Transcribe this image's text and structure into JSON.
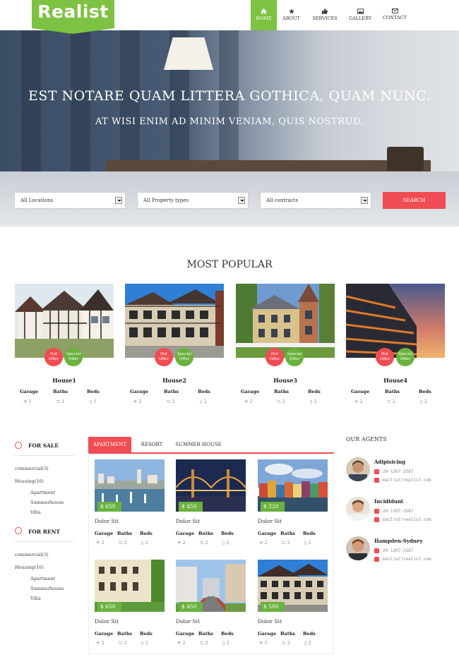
{
  "header": {
    "logo": "Realist",
    "nav": [
      {
        "label": "HOME",
        "icon": "home-icon",
        "active": true
      },
      {
        "label": "ABOUT",
        "icon": "user-icon",
        "active": false
      },
      {
        "label": "SERVICES",
        "icon": "thumbs-up-icon",
        "active": false
      },
      {
        "label": "GALLERY",
        "icon": "image-icon",
        "active": false
      },
      {
        "label": "CONTACT",
        "icon": "envelope-icon",
        "active": false
      }
    ]
  },
  "hero": {
    "title": "EST NOTARE QUAM LITTERA GOTHICA, QUAM NUNC.",
    "subtitle": "AT WISI ENIM AD MINIM VENIAM, QUIS NOSTRUD.",
    "location_select": "All Locations",
    "type_select": "All Property types",
    "contract_select": "All contracts",
    "search_label": "SEARCH"
  },
  "popular": {
    "title": "MOST POPULAR",
    "badge_hot": "Hot Offer",
    "badge_special": "Special Offer",
    "spec_labels": [
      "Garage",
      "Baths",
      "Beds"
    ],
    "houses": [
      {
        "name": "House1",
        "garage": "1",
        "baths": "1",
        "beds": "1"
      },
      {
        "name": "House2",
        "garage": "2",
        "baths": "2",
        "beds": "2"
      },
      {
        "name": "House3",
        "garage": "2",
        "baths": "2",
        "beds": "2"
      },
      {
        "name": "House4",
        "garage": "2",
        "baths": "2",
        "beds": "2"
      }
    ]
  },
  "sidebar": {
    "sale_heading": "FOR SALE",
    "rent_heading": "FOR RENT",
    "sale_items": [
      "commercial(3)",
      "Housing(16)",
      "Apartment",
      "Summerhouse",
      "Villa"
    ],
    "rent_items": [
      "commercial(3)",
      "Housing(16)",
      "Apartment",
      "Summerhouse",
      "Villa"
    ]
  },
  "listings": {
    "tabs": [
      "APARTMENT",
      "RESORT",
      "SUMMER HOUSE"
    ],
    "spec_labels": [
      "Garage",
      "Baths",
      "Beds"
    ],
    "items": [
      {
        "price": "$ 650",
        "title": "Dolor Sit",
        "garage": "2",
        "baths": "2",
        "beds": "2"
      },
      {
        "price": "$ 450",
        "title": "Dolor Sit",
        "garage": "2",
        "baths": "2",
        "beds": "2"
      },
      {
        "price": "$ 220",
        "title": "Dolor Sit",
        "garage": "2",
        "baths": "2",
        "beds": "2"
      },
      {
        "price": "$ 650",
        "title": "Dolor Sit",
        "garage": "2",
        "baths": "2",
        "beds": "2"
      },
      {
        "price": "$ 450",
        "title": "Dolor Sit",
        "garage": "2",
        "baths": "2",
        "beds": "2"
      },
      {
        "price": "$ 500",
        "title": "Dolor Sit",
        "garage": "2",
        "baths": "2",
        "beds": "2"
      }
    ]
  },
  "agents": {
    "title": "OUR AGENTS",
    "list": [
      {
        "name": "Adipisicing",
        "phone": "20-1207-2587",
        "email": "mail(at)realist.com"
      },
      {
        "name": "Incididunt",
        "phone": "20-1207-2587",
        "email": "mail(at)realist.com"
      },
      {
        "name": "Hampden-Sydney",
        "phone": "20-1207-2587",
        "email": "mail(at)realist.com"
      }
    ]
  },
  "colors": {
    "brand_green": "#7dc242",
    "accent_red": "#f04c53",
    "price_green": "#6ab23e"
  }
}
